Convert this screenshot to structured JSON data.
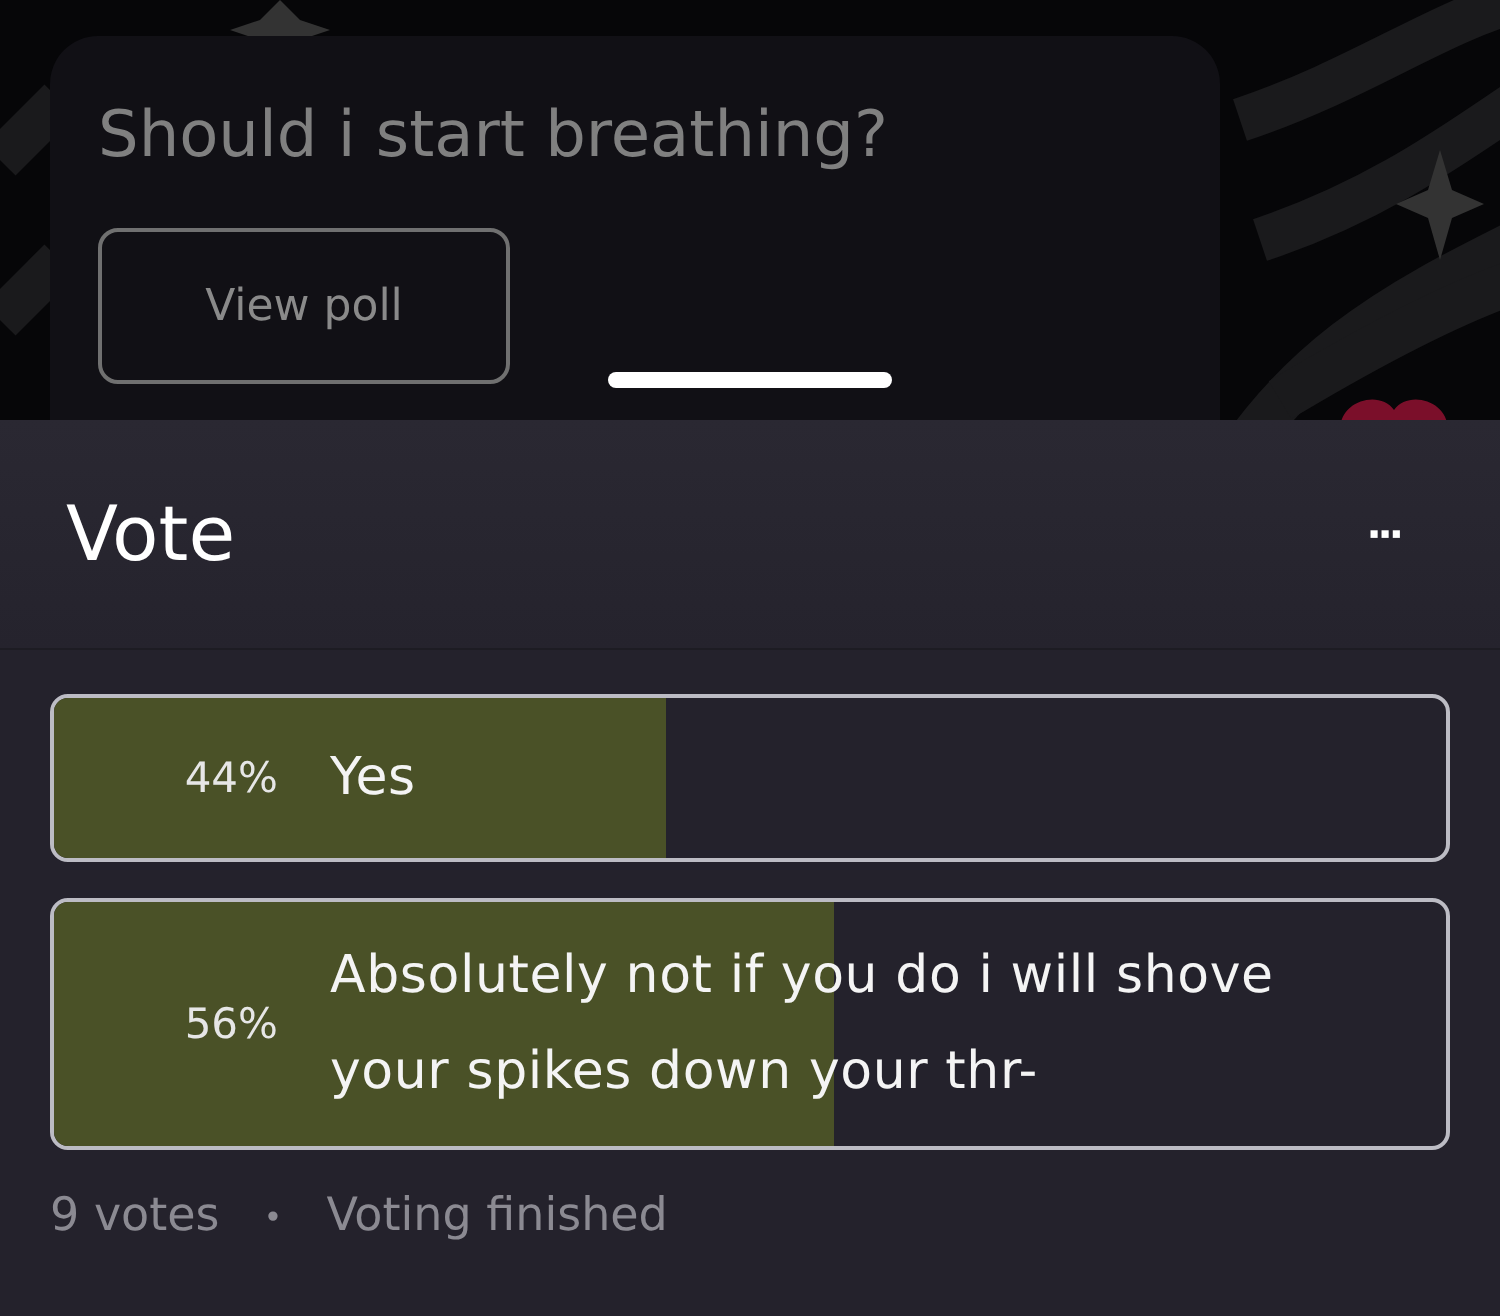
{
  "post": {
    "question": "Should i start breathing?",
    "button": "View poll"
  },
  "sheet": {
    "title": "Vote",
    "menu": "···"
  },
  "options": [
    {
      "percent": "44%",
      "label": "Yes",
      "level": 0.44
    },
    {
      "percent": "56%",
      "label": "Absolutely not if you do i will shove your spikes down your thr-",
      "level": 0.56
    }
  ],
  "footer": {
    "votes": "9 votes",
    "separator": "•",
    "status": "Voting finished"
  }
}
